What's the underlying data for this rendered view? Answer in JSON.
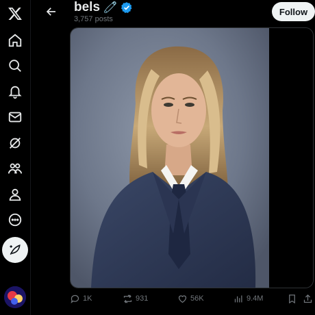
{
  "sidebar": {
    "items": [
      {
        "icon": "x-logo-icon"
      },
      {
        "icon": "home-icon"
      },
      {
        "icon": "search-icon"
      },
      {
        "icon": "bell-icon"
      },
      {
        "icon": "mail-icon"
      },
      {
        "icon": "grok-icon"
      },
      {
        "icon": "communities-icon"
      },
      {
        "icon": "profile-icon"
      },
      {
        "icon": "more-icon"
      }
    ],
    "compose_icon": "feather-compose-icon"
  },
  "header": {
    "name": "bels",
    "emoji": "🧷",
    "posts_count": "3,757 posts",
    "follow_label": "Follow",
    "verified_color": "#1d9bf0"
  },
  "post": {
    "media_alt": "portrait photo of a woman with long blonde hair wearing a navy suit and tie",
    "actions": {
      "replies": "1K",
      "reposts": "931",
      "likes": "56K",
      "views": "9.4M"
    }
  },
  "colors": {
    "background": "#000000",
    "muted": "#71767b",
    "text": "#e7e9ea",
    "accent": "#1d9bf0"
  }
}
